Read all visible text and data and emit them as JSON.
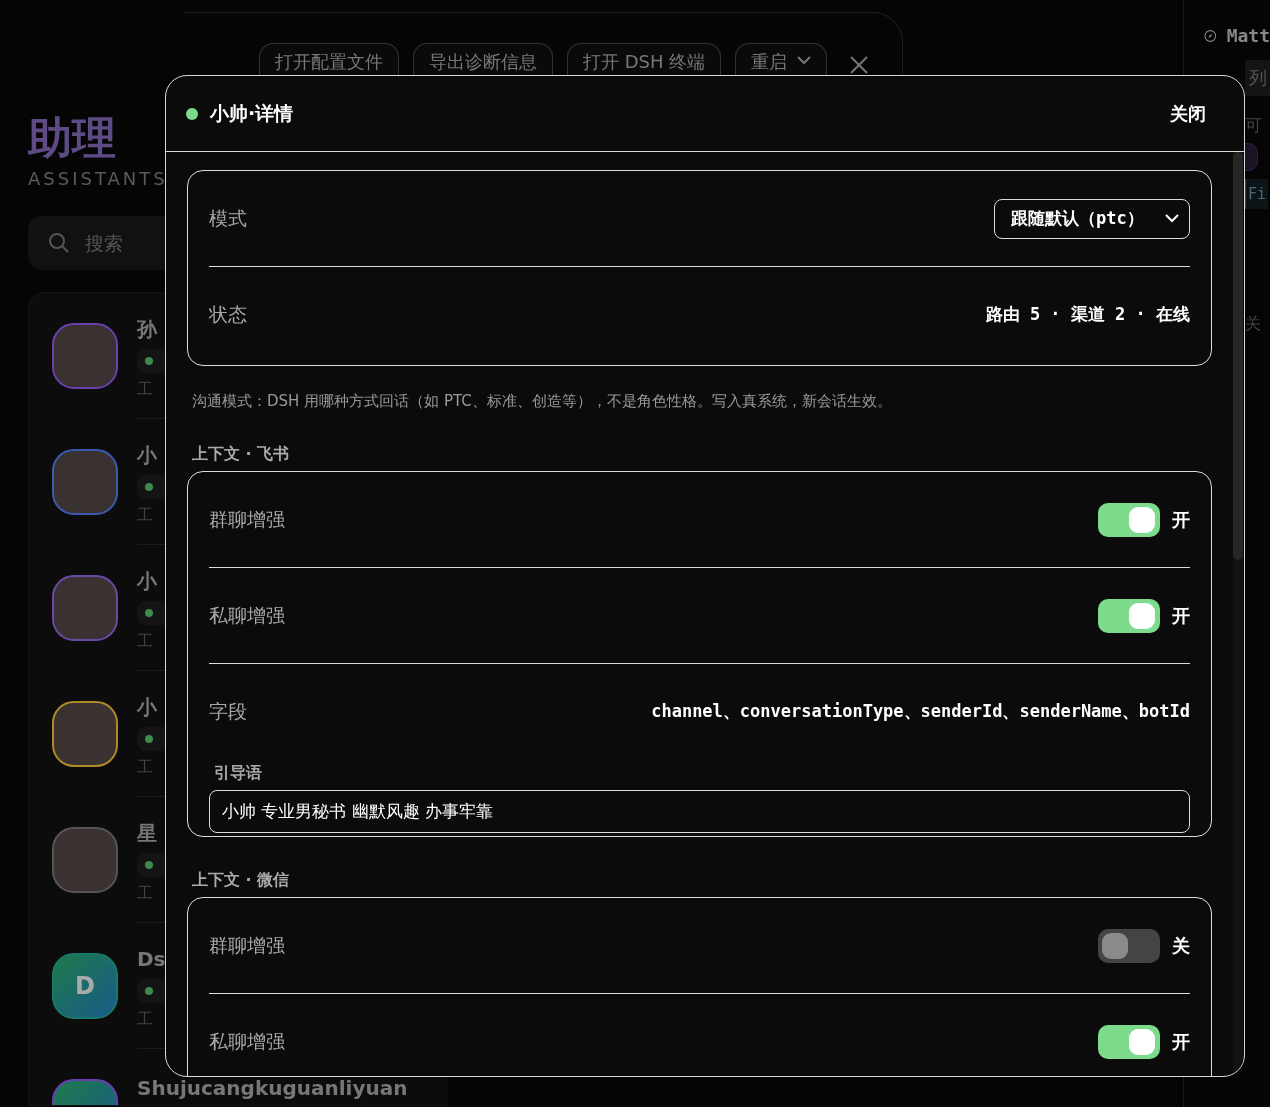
{
  "toolbar": {
    "buttons": [
      {
        "label": "打开配置文件",
        "kind": "plain"
      },
      {
        "label": "导出诊断信息",
        "kind": "plain"
      },
      {
        "label": "打开 DSH 终端",
        "kind": "plain"
      },
      {
        "label": "重启",
        "kind": "dropdown"
      }
    ]
  },
  "sidebar": {
    "title": "助理",
    "subtitle": "ASSISTANTS",
    "search": {
      "placeholder": "搜索"
    },
    "assistants": [
      {
        "name": "孙",
        "online": true,
        "role": "工",
        "kind": "photo",
        "color": "#6a3fb0"
      },
      {
        "name": "小",
        "online": true,
        "role": "工",
        "kind": "photo",
        "color": "#3a5bb0"
      },
      {
        "name": "小",
        "online": true,
        "role": "工",
        "kind": "photo",
        "color": "#6a4aa8"
      },
      {
        "name": "小",
        "online": true,
        "role": "工",
        "kind": "photo",
        "color": "#b08a2a"
      },
      {
        "name": "星",
        "online": true,
        "role": "工",
        "kind": "photo",
        "color": "#555555"
      },
      {
        "name": "Ds",
        "online": true,
        "role": "工",
        "kind": "letter",
        "letter": "D",
        "color": "#1a7a6a"
      },
      {
        "name": "Shujucangkuguanliyuan",
        "kind": "letter",
        "color": "#6a3fb0"
      }
    ]
  },
  "side_panel": {
    "title": "Matt",
    "list_button": "列",
    "hint": "可",
    "filter": "Fi",
    "close": "关"
  },
  "modal": {
    "title": "小帅·详情",
    "online": true,
    "close": "关闭",
    "sections": [
      {
        "kind": "card",
        "rows": [
          {
            "kind": "select",
            "label": "模式",
            "value": "跟随默认（ptc）"
          },
          {
            "kind": "text",
            "label": "状态",
            "value": "路由 5 · 渠道 2 · 在线"
          }
        ]
      },
      {
        "kind": "note",
        "text": "沟通模式：DSH 用哪种方式回话（如 PTC、标准、创造等），不是角色性格。写入真系统，新会话生效。"
      },
      {
        "kind": "heading",
        "text": "上下文 · 飞书"
      },
      {
        "kind": "card",
        "rows": [
          {
            "kind": "toggle",
            "label": "群聊增强",
            "on": true,
            "state_label": "开"
          },
          {
            "kind": "toggle",
            "label": "私聊增强",
            "on": true,
            "state_label": "开"
          },
          {
            "kind": "text",
            "label": "字段",
            "value": "channel、conversationType、senderId、senderName、botId"
          },
          {
            "kind": "input",
            "label": "引导语",
            "value": "小帅 专业男秘书 幽默风趣 办事牢靠"
          }
        ]
      },
      {
        "kind": "heading",
        "text": "上下文 · 微信"
      },
      {
        "kind": "card",
        "rows": [
          {
            "kind": "toggle",
            "label": "群聊增强",
            "on": false,
            "state_label": "关"
          },
          {
            "kind": "toggle",
            "label": "私聊增强",
            "on": true,
            "state_label": "开"
          }
        ]
      }
    ]
  }
}
